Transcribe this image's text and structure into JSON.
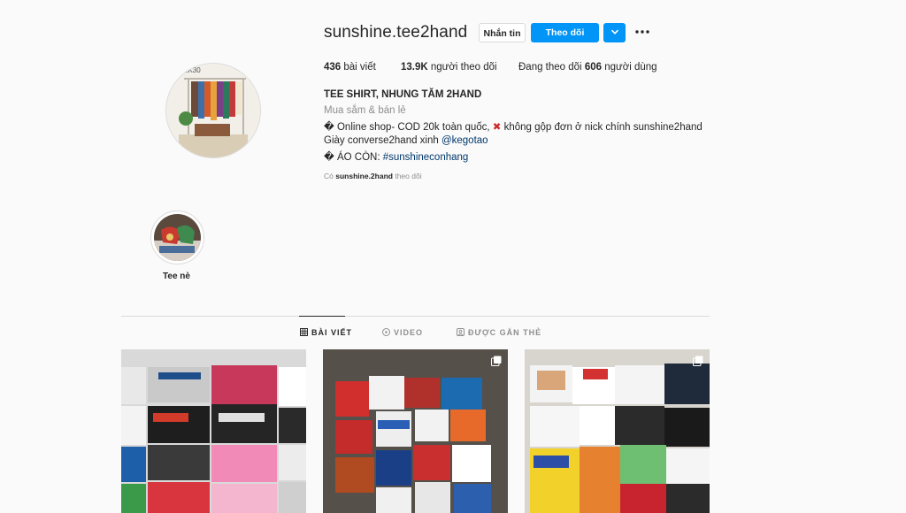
{
  "profile": {
    "username": "sunshine.tee2hand",
    "message_button": "Nhắn tin",
    "follow_button": "Theo dõi",
    "stats": {
      "posts_count": "436",
      "posts_label": "bài viết",
      "followers_count": "13.9K",
      "followers_label": "người theo dõi",
      "following_prefix": "Đang theo dõi",
      "following_count": "606",
      "following_label": "người dùng"
    },
    "full_name": "TEE SHIRT, NHUNG TĂM 2HAND",
    "category": "Mua sắm & bán lẻ",
    "bio": {
      "line1_a": "� Online shop- COD 20k toàn quốc, ",
      "line1_icon": "✖",
      "line1_b": " không gộp đơn ở nick chính sunshine2hand",
      "line2_text": "Giày converse2hand xinh ",
      "line2_link": "@kegotao",
      "line3_text": "� ÁO CÒN: ",
      "line3_link": "#sunshineconhang"
    },
    "followed_by_prefix": "Có",
    "followed_by_user": "sunshine.2hand",
    "followed_by_suffix": "theo dõi",
    "avatar_brand": "1K30"
  },
  "highlights": [
    {
      "label": "Tee nè"
    }
  ],
  "tabs": [
    {
      "label": "BÀI VIẾT",
      "icon": "grid-icon",
      "active": true
    },
    {
      "label": "VIDEO",
      "icon": "play-icon",
      "active": false
    },
    {
      "label": "ĐƯỢC GẮN THẺ",
      "icon": "tag-icon",
      "active": false
    }
  ],
  "posts": [
    {
      "icon": "none"
    },
    {
      "icon": "multiple-posts-icon"
    },
    {
      "icon": "multiple-posts-icon"
    }
  ],
  "colors": {
    "accent": "#0095f6",
    "link": "#00376b",
    "muted": "#8e8e8e",
    "border": "#dbdbdb"
  }
}
